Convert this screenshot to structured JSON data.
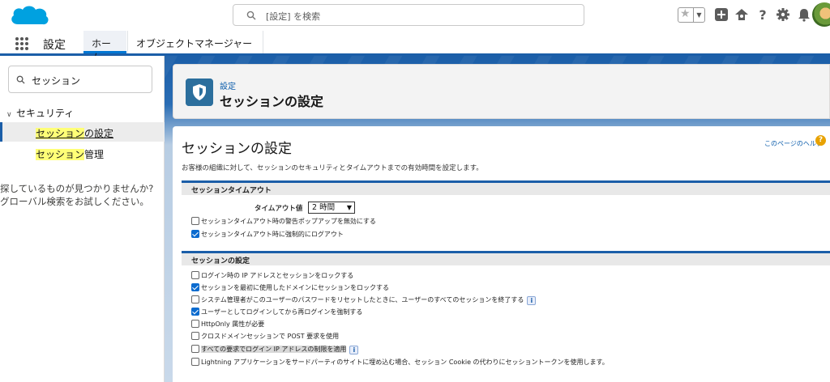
{
  "top_bar": {
    "search_placeholder": "[設定] を検索",
    "icons": [
      "salesforce-cloud-logo",
      "search-icon",
      "favorites-star-icon",
      "dropdown-icon",
      "add-icon",
      "trailhead-icon",
      "help-icon",
      "gear-icon",
      "bell-icon",
      "user-avatar"
    ]
  },
  "nav_bar": {
    "app_name": "設定",
    "tabs": [
      {
        "label": "ホーム"
      },
      {
        "label": "オブジェクトマネージャー"
      }
    ],
    "tab_dropdown_glyph": "⌄"
  },
  "sidebar": {
    "quick_find_value": "セッション",
    "tree_section": "セキュリティ",
    "items": [
      {
        "highlight": "セッション",
        "rest": "の設定"
      },
      {
        "highlight": "セッション",
        "rest": "管理"
      }
    ],
    "not_found_line1": "探しているものが見つかりませんか?",
    "not_found_line2": "グローバル検索をお試しください。"
  },
  "header": {
    "breadcrumb": "設定",
    "title": "セッションの設定"
  },
  "main": {
    "page_title": "セッションの設定",
    "help_link": "このページのヘルプ",
    "help_icon_glyph": "?",
    "description": "お客様の組織に対して、セッションのセキュリティとタイムアウトまでの有効時間を設定します。",
    "timeout_section": {
      "title": "セッションタイムアウト",
      "timeout_label": "タイムアウト値",
      "timeout_value": "2 時間",
      "options": [
        {
          "label": "セッションタイムアウト時の警告ポップアップを無効にする",
          "checked": false
        },
        {
          "label": "セッションタイムアウト時に強制的にログアウト",
          "checked": true
        }
      ]
    },
    "session_section": {
      "title": "セッションの設定",
      "info_glyph": "i",
      "options": [
        {
          "label": "ログイン時の IP アドレスとセッションをロックする",
          "checked": false
        },
        {
          "label": "セッションを最初に使用したドメインにセッションをロックする",
          "checked": true
        },
        {
          "label": "システム管理者がこのユーザーのパスワードをリセットしたときに、ユーザーのすべてのセッションを終了する",
          "checked": false,
          "info": true
        },
        {
          "label": "ユーザーとしてログインしてから再ログインを強制する",
          "checked": true
        },
        {
          "label": "HttpOnly 属性が必要",
          "checked": false
        },
        {
          "label": "クロスドメインセッションで POST 要求を使用",
          "checked": false
        },
        {
          "label": "すべての要求でログイン IP アドレスの制限を適用",
          "checked": false,
          "info": true
        },
        {
          "label": "Lightning アプリケーションをサードパーティのサイトに埋め込む場合、セッション Cookie の代わりにセッショントークンを使用します。",
          "checked": false
        }
      ]
    }
  },
  "colors": {
    "brand_blue": "#1b5ea8",
    "link_blue": "#0b5cab",
    "highlight_yellow": "#ffff77",
    "checkbox_blue": "#0b6bcf",
    "help_orange": "#e8a202"
  }
}
